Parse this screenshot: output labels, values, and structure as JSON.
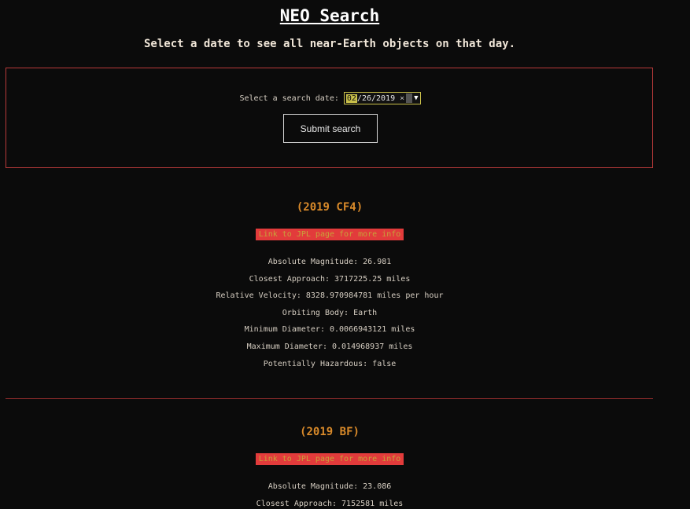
{
  "header": {
    "title": "NEO Search",
    "subtitle": "Select a date to see all near-Earth objects on that day."
  },
  "search": {
    "label": "Select a search date:",
    "date_month": "02",
    "date_rest": "/26/2019",
    "clear_glyph": "×",
    "dropdown_glyph": "▼",
    "submit_label": "Submit search"
  },
  "neos": [
    {
      "name": "(2019 CF4)",
      "link_text": "Link to JPL page for more info",
      "facts": [
        "Absolute Magnitude: 26.981",
        "Closest Approach: 3717225.25 miles",
        "Relative Velocity: 8328.970984781 miles per hour",
        "Orbiting Body: Earth",
        "Minimum Diameter: 0.0066943121 miles",
        "Maximum Diameter: 0.014968937 miles",
        "Potentially Hazardous: false"
      ]
    },
    {
      "name": "(2019 BF)",
      "link_text": "Link to JPL page for more info",
      "facts": [
        "Absolute Magnitude: 23.086",
        "Closest Approach: 7152581 miles"
      ]
    }
  ],
  "colors": {
    "background": "#0b0b0b",
    "accent_border": "#b83a3a",
    "neo_name": "#d98a2a",
    "link_bg": "#e23b3b"
  }
}
